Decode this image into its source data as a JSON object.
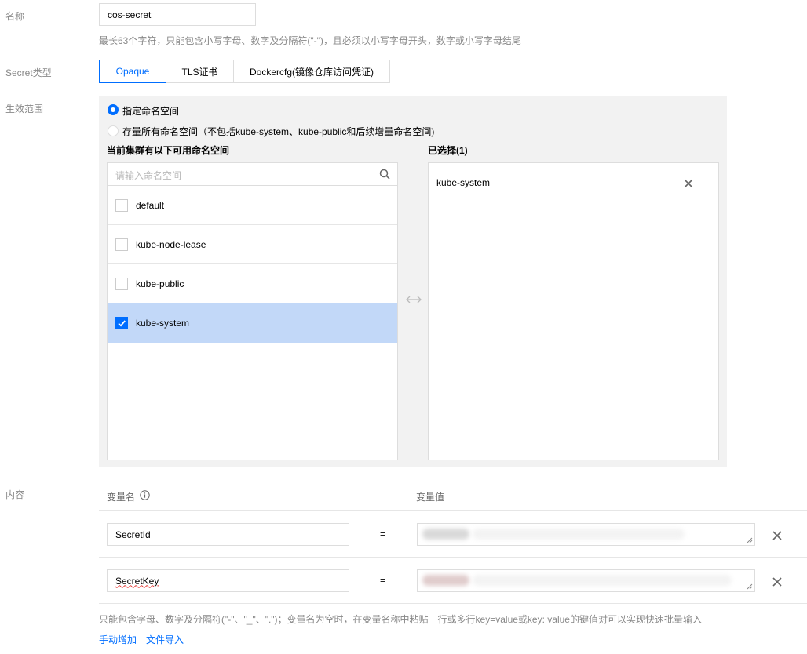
{
  "name_field": {
    "label": "名称",
    "value": "cos-secret",
    "hint": "最长63个字符，只能包含小写字母、数字及分隔符(\"-\")，且必须以小写字母开头，数字或小写字母结尾"
  },
  "secret_type": {
    "label": "Secret类型",
    "options": [
      "Opaque",
      "TLS证书",
      "Dockercfg(镜像仓库访问凭证)"
    ],
    "selected": "Opaque"
  },
  "scope": {
    "label": "生效范围",
    "radio_specified": "指定命名空间",
    "radio_all": "存量所有命名空间（不包括kube-system、kube-public和后续增量命名空间)",
    "selected": "指定命名空间",
    "available_title": "当前集群有以下可用命名空间",
    "search_placeholder": "请输入命名空间",
    "namespaces": [
      {
        "name": "default",
        "checked": false
      },
      {
        "name": "kube-node-lease",
        "checked": false
      },
      {
        "name": "kube-public",
        "checked": false
      },
      {
        "name": "kube-system",
        "checked": true
      }
    ],
    "selected_title": "已选择(1)",
    "selected_items": [
      "kube-system"
    ]
  },
  "content": {
    "label": "内容",
    "col_key": "变量名",
    "col_value": "变量值",
    "equals": "=",
    "rows": [
      {
        "key": "SecretId"
      },
      {
        "key": "SecretKey"
      }
    ],
    "hint": "只能包含字母、数字及分隔符(\"-\"、\"_\"、\".\")；变量名为空时，在变量名称中粘贴一行或多行key=value或key: value的键值对可以实现快速批量输入",
    "add_manual": "手动增加",
    "import_file": "文件导入"
  },
  "colors": {
    "accent": "#006eff",
    "selected_row": "#c2d8f8",
    "panel_bg": "#f2f2f2"
  }
}
